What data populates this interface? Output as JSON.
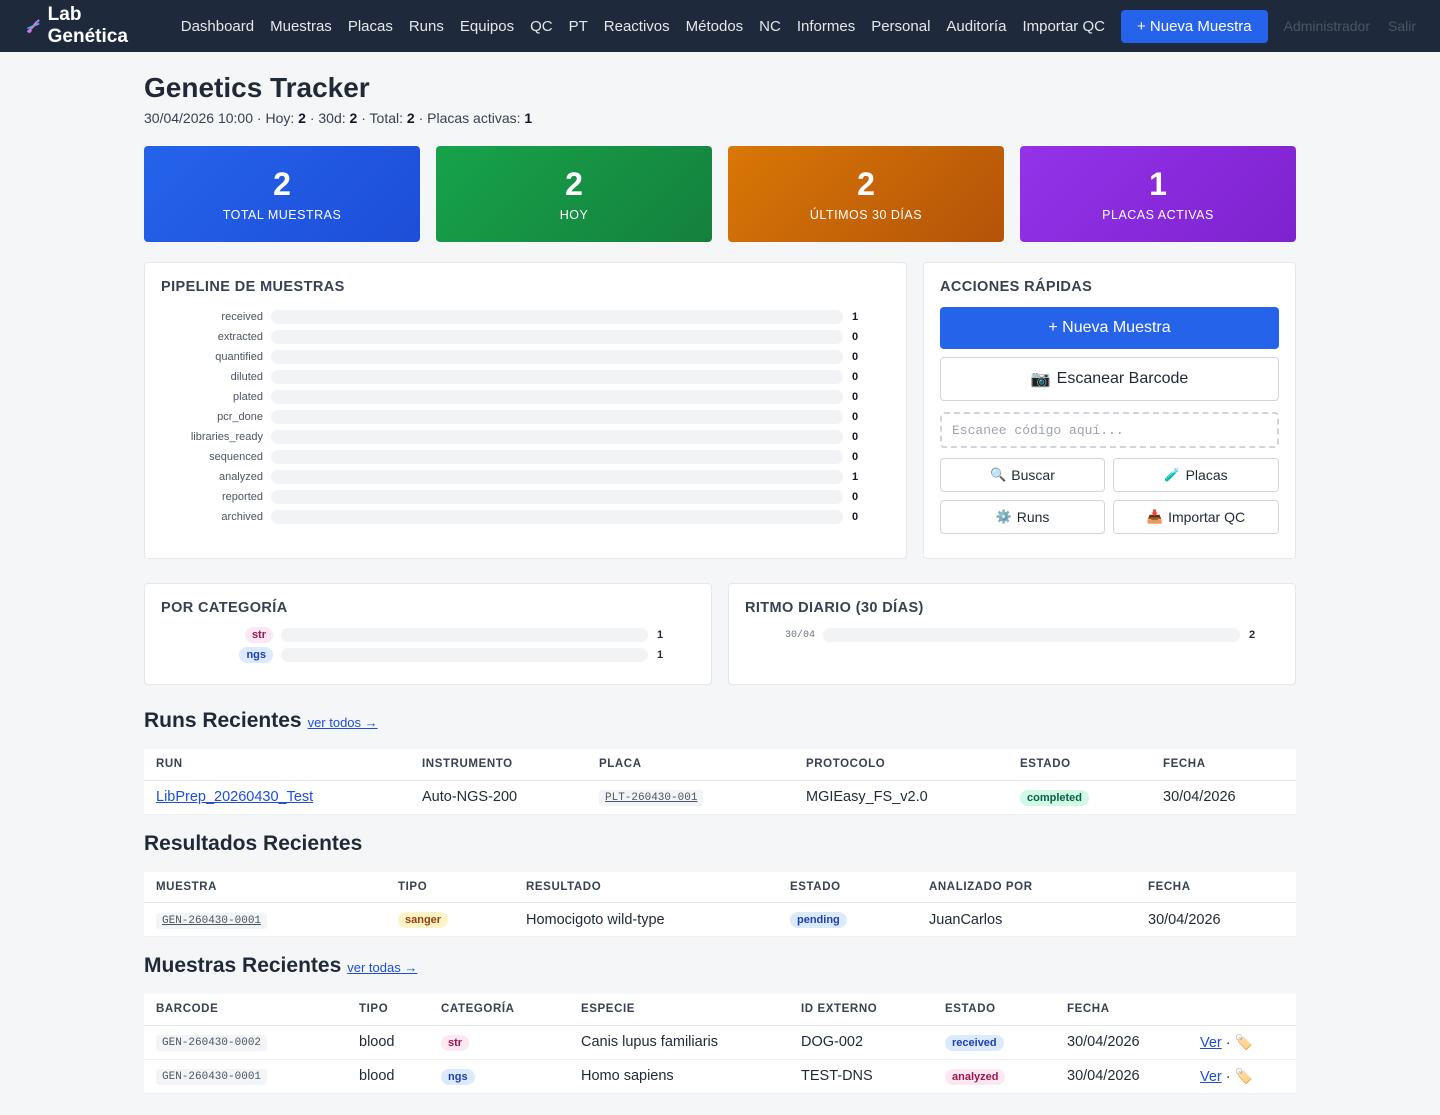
{
  "nav": {
    "brand": "Lab Genética",
    "brand_icon": "dna-icon",
    "links": [
      "Dashboard",
      "Muestras",
      "Placas",
      "Runs",
      "Equipos",
      "QC",
      "PT",
      "Reactivos",
      "Métodos",
      "NC",
      "Informes",
      "Personal",
      "Auditoría",
      "Importar QC"
    ],
    "new_sample": "+ Nueva Muestra",
    "user": "Administrador",
    "logout": "Salir"
  },
  "header": {
    "title": "Genetics Tracker",
    "datetime": "30/04/2026 10:00",
    "hoy_label": "Hoy:",
    "hoy": "2",
    "d30_label": "30d:",
    "d30": "2",
    "total_label": "Total:",
    "total": "2",
    "placas_label": "Placas activas:",
    "placas": "1"
  },
  "stats": [
    {
      "value": "2",
      "label": "Total Muestras",
      "color": "#2563eb"
    },
    {
      "value": "2",
      "label": "Hoy",
      "color": "#16a34a"
    },
    {
      "value": "2",
      "label": "Últimos 30 días",
      "color": "#d97706"
    },
    {
      "value": "1",
      "label": "Placas activas",
      "color": "#9333ea"
    }
  ],
  "pipeline": {
    "title": "Pipeline de muestras",
    "stages": [
      {
        "name": "received",
        "count": 1
      },
      {
        "name": "extracted",
        "count": 0
      },
      {
        "name": "quantified",
        "count": 0
      },
      {
        "name": "diluted",
        "count": 0
      },
      {
        "name": "plated",
        "count": 0
      },
      {
        "name": "pcr_done",
        "count": 0
      },
      {
        "name": "libraries_ready",
        "count": 0
      },
      {
        "name": "sequenced",
        "count": 0
      },
      {
        "name": "analyzed",
        "count": 1
      },
      {
        "name": "reported",
        "count": 0
      },
      {
        "name": "archived",
        "count": 0
      }
    ]
  },
  "actions": {
    "title": "Acciones rápidas",
    "new_sample": "+ Nueva Muestra",
    "scan_icon": "camera-icon",
    "scan": "Escanear Barcode",
    "scan_placeholder": "Escanee código aquí...",
    "buttons": [
      {
        "icon": "search-icon",
        "label": "Buscar"
      },
      {
        "icon": "test-tube-icon",
        "label": "Placas"
      },
      {
        "icon": "gear-icon",
        "label": "Runs"
      },
      {
        "icon": "inbox-icon",
        "label": "Importar QC"
      }
    ]
  },
  "categories": {
    "title": "Por categoría",
    "items": [
      {
        "name": "str",
        "count": 1
      },
      {
        "name": "ngs",
        "count": 1
      }
    ]
  },
  "daily": {
    "title": "Ritmo diario (30 días)",
    "items": [
      {
        "date": "30/04",
        "count": 2
      }
    ]
  },
  "runs": {
    "title": "Runs Recientes",
    "link": "ver todos →",
    "headers": [
      "Run",
      "Instrumento",
      "Placa",
      "Protocolo",
      "Estado",
      "Fecha"
    ],
    "rows": [
      {
        "run": "LibPrep_20260430_Test",
        "instrument": "Auto-NGS-200",
        "plate": "PLT-260430-001",
        "protocol": "MGIEasy_FS_v2.0",
        "status": "completed",
        "date": "30/04/2026"
      }
    ]
  },
  "results": {
    "title": "Resultados Recientes",
    "headers": [
      "Muestra",
      "Tipo",
      "Resultado",
      "Estado",
      "Analizado por",
      "Fecha"
    ],
    "rows": [
      {
        "sample": "GEN-260430-0001",
        "type": "sanger",
        "result": "Homocigoto wild-type",
        "status": "pending",
        "analyst": "JuanCarlos",
        "date": "30/04/2026"
      }
    ]
  },
  "samples": {
    "title": "Muestras Recientes",
    "link": "ver todas →",
    "headers": [
      "Barcode",
      "Tipo",
      "Categoría",
      "Especie",
      "ID Externo",
      "Estado",
      "Fecha",
      ""
    ],
    "view_label": "Ver",
    "sep": "·",
    "rows": [
      {
        "barcode": "GEN-260430-0002",
        "type": "blood",
        "category": "str",
        "species": "Canis lupus familiaris",
        "ext_id": "DOG-002",
        "status": "received",
        "date": "30/04/2026"
      },
      {
        "barcode": "GEN-260430-0001",
        "type": "blood",
        "category": "ngs",
        "species": "Homo sapiens",
        "ext_id": "TEST-DNS",
        "status": "analyzed",
        "date": "30/04/2026"
      }
    ]
  }
}
